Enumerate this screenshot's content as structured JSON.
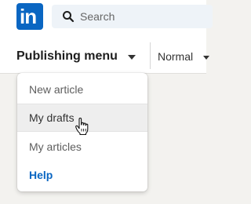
{
  "header": {
    "logo_text": "in",
    "search": {
      "placeholder": "Search"
    }
  },
  "toolbar": {
    "publishing_menu_label": "Publishing menu",
    "text_style_value": "Normal"
  },
  "publishing_menu": {
    "items": [
      {
        "label": "New article"
      },
      {
        "label": "My drafts",
        "hovered": true
      },
      {
        "label": "My articles"
      },
      {
        "label": "Help"
      }
    ]
  },
  "colors": {
    "brand": "#0a66c2",
    "menu_hover": "#eeeeee",
    "page_bg": "#f3f2ef"
  },
  "icons": [
    "linkedin-logo",
    "search-icon",
    "caret-down-icon",
    "hand-pointer-cursor"
  ]
}
